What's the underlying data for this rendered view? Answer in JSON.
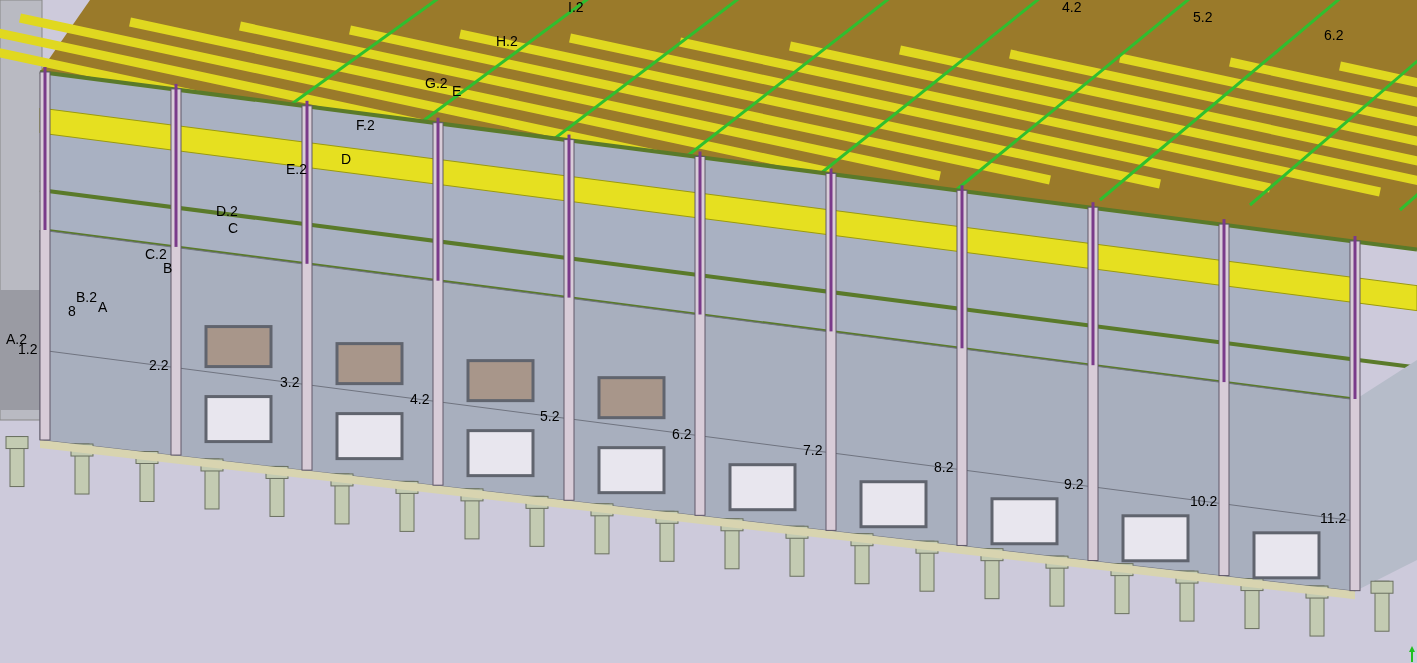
{
  "viewport": {
    "grid_labels": [
      {
        "text": "I.2"
      },
      {
        "text": "4.2"
      },
      {
        "text": "5.2"
      },
      {
        "text": "6.2"
      },
      {
        "text": "H.2"
      },
      {
        "text": "G.2"
      },
      {
        "text": "E"
      },
      {
        "text": "F.2"
      },
      {
        "text": "D"
      },
      {
        "text": "E.2"
      },
      {
        "text": "D.2"
      },
      {
        "text": "C"
      },
      {
        "text": "C.2"
      },
      {
        "text": "B"
      },
      {
        "text": "B.2"
      },
      {
        "text": "8"
      },
      {
        "text": "A"
      },
      {
        "text": "A.2"
      },
      {
        "text": "1.2"
      },
      {
        "text": "2.2"
      },
      {
        "text": "3.2"
      },
      {
        "text": "4.2"
      },
      {
        "text": "5.2"
      },
      {
        "text": "6.2"
      },
      {
        "text": "7.2"
      },
      {
        "text": "8.2"
      },
      {
        "text": "9.2"
      },
      {
        "text": "10.2"
      },
      {
        "text": "11.2"
      }
    ]
  }
}
